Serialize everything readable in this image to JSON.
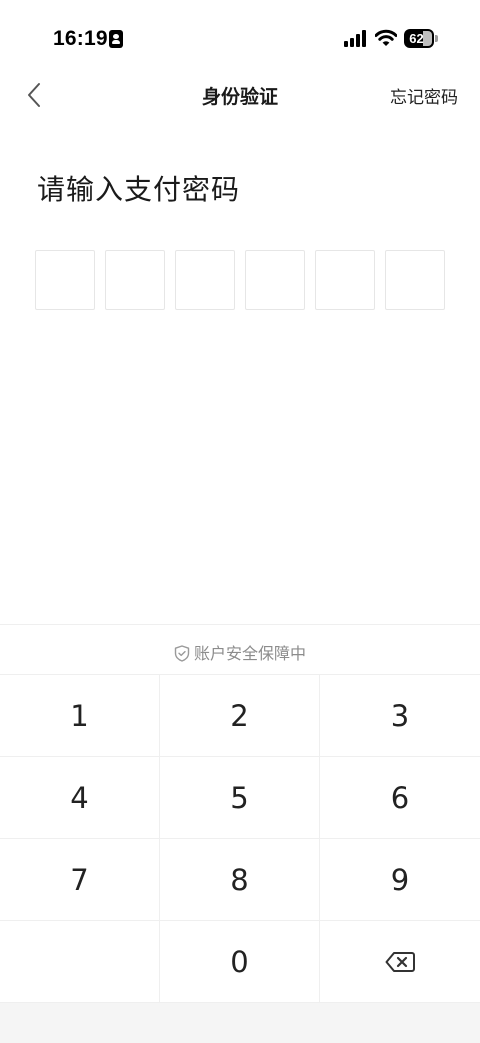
{
  "status_bar": {
    "time": "16:19",
    "battery_level": "62",
    "icons": [
      "contact-card-icon",
      "cellular-signal-icon",
      "wifi-icon",
      "battery-icon"
    ]
  },
  "nav": {
    "back_icon": "chevron-left-icon",
    "title": "身份验证",
    "forgot_label": "忘记密码"
  },
  "prompt": {
    "title": "请输入支付密码"
  },
  "pin": {
    "length": 6,
    "entered": 0
  },
  "keyboard": {
    "security_text": "账户安全保障中",
    "security_icon": "shield-check-icon",
    "keys": [
      "1",
      "2",
      "3",
      "4",
      "5",
      "6",
      "7",
      "8",
      "9",
      "",
      "0",
      "delete"
    ],
    "delete_icon": "backspace-icon"
  },
  "colors": {
    "text_primary": "#1a1a1a",
    "text_secondary": "#8c8c8c",
    "divider": "#efefef",
    "pin_border": "#e6e6e6",
    "bottom_strip": "#f5f5f5"
  }
}
